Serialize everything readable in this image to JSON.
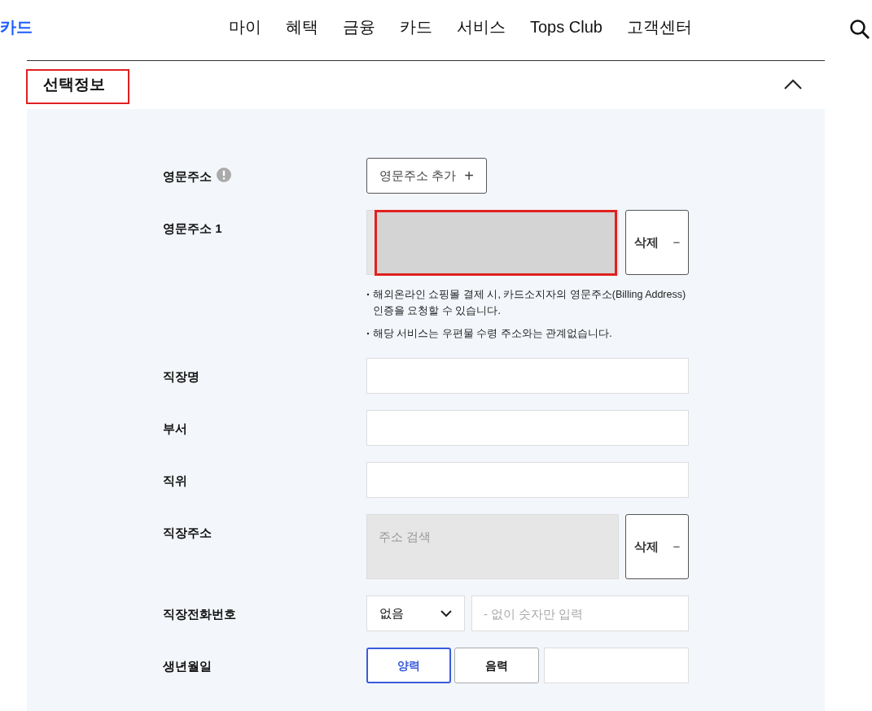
{
  "header": {
    "logo": "카드",
    "nav": [
      "마이",
      "혜택",
      "금융",
      "카드",
      "서비스",
      "Tops Club",
      "고객센터"
    ]
  },
  "section": {
    "title": "선택정보",
    "expanded": true,
    "title_highlighted": true
  },
  "rows": [
    {
      "kind": "add",
      "label": "영문주소",
      "info": true,
      "button": "영문주소 추가",
      "button_symbol": "+"
    },
    {
      "kind": "address",
      "label": "영문주소 1",
      "highlighted": true,
      "button": "삭제",
      "button_symbol": "−",
      "notes": [
        "해외온라인 쇼핑몰 결제 시, 카드소지자의 영문주소(Billing Address) 인증을 요청할 수 있습니다.",
        "해당 서비스는 우편물 수령 주소와는 관계없습니다."
      ]
    },
    {
      "kind": "text",
      "label": "직장명"
    },
    {
      "kind": "text",
      "label": "부서"
    },
    {
      "kind": "text",
      "label": "직위"
    },
    {
      "kind": "address",
      "label": "직장주소",
      "placeholder": "주소 검색",
      "highlighted": false,
      "button": "삭제",
      "button_symbol": "−"
    },
    {
      "kind": "phone",
      "label": "직장전화번호",
      "select": "없음",
      "placeholder": "- 없이 숫자만 입력"
    },
    {
      "kind": "birth",
      "label": "생년월일",
      "options": [
        {
          "label": "양력",
          "selected": true
        },
        {
          "label": "음력",
          "selected": false
        }
      ]
    }
  ]
}
